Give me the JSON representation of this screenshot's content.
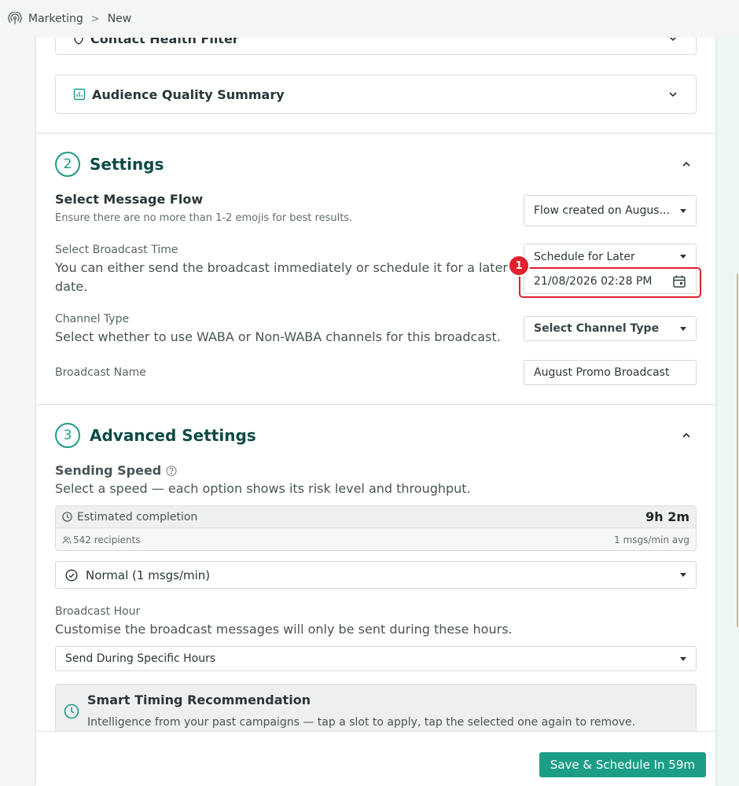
{
  "breadcrumb": {
    "items": [
      "Marketing",
      "New"
    ],
    "separator": ">"
  },
  "accordions": {
    "contact_health": "Contact Health Filter",
    "audience_quality": "Audience Quality Summary"
  },
  "settings": {
    "number": "2",
    "title": "Settings",
    "message_flow": {
      "label": "Select Message Flow",
      "description": "Ensure there are no more than 1-2 emojis for best results.",
      "value": "Flow created on Augus..."
    },
    "broadcast_time": {
      "label": "Select Broadcast Time",
      "description_line1": "You can either send the broadcast immediately or schedule it for a later",
      "description_line2": "date.",
      "value": "Schedule for Later",
      "datetime": "21/08/2026 02:28 PM"
    },
    "channel_type": {
      "label": "Channel Type",
      "description": "Select whether to use WABA or Non-WABA channels for this broadcast.",
      "value": "Select Channel Type"
    },
    "broadcast_name": {
      "label": "Broadcast Name",
      "value": "August Promo Broadcast"
    }
  },
  "annotation": {
    "badge": "1",
    "color": "#e0202b"
  },
  "advanced": {
    "number": "3",
    "title": "Advanced Settings",
    "sending_speed": {
      "label": "Sending Speed",
      "description": "Select a speed — each option shows its risk level and throughput.",
      "estimate_label": "Estimated completion",
      "estimate_value": "9h 2m",
      "recipients": "542 recipients",
      "rate": "1 msgs/min avg",
      "selected": "Normal (1 msgs/min)"
    },
    "broadcast_hour": {
      "label": "Broadcast Hour",
      "description": "Customise the broadcast messages will only be sent during these hours.",
      "value": "Send During Specific Hours"
    },
    "smart_timing": {
      "title": "Smart Timing Recommendation",
      "description": "Intelligence from your past campaigns — tap a slot to apply, tap the selected one again to remove."
    }
  },
  "footer": {
    "save_label": "Save & Schedule In 59m"
  },
  "colors": {
    "accent": "#1c9e86",
    "heading": "#0d4a47"
  }
}
